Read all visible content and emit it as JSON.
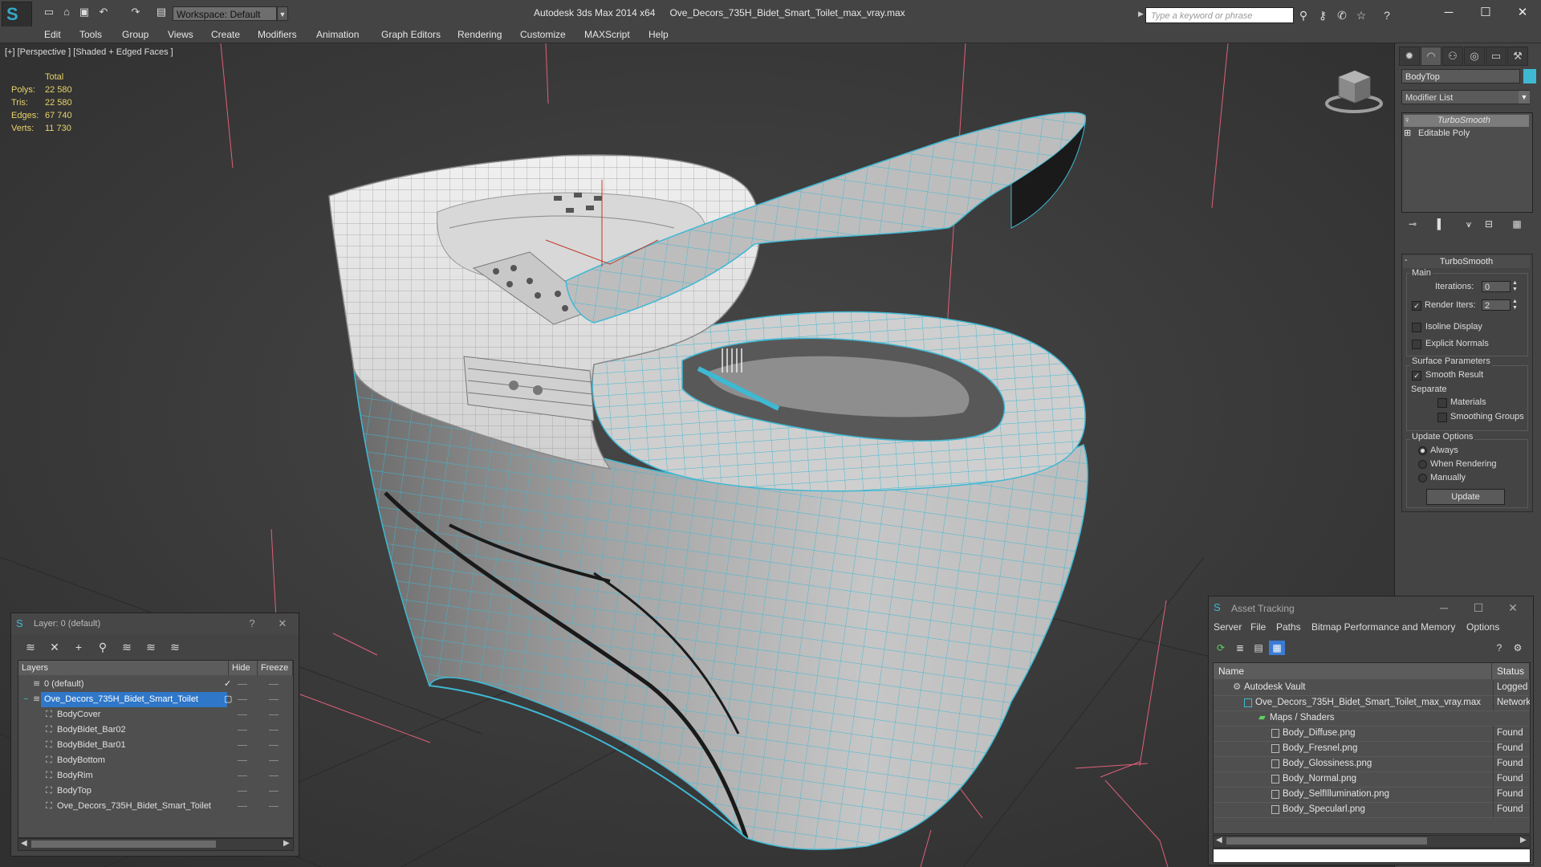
{
  "app": {
    "name": "Autodesk 3ds Max  2014 x64",
    "file": "Ove_Decors_735H_Bidet_Smart_Toilet_max_vray.max",
    "workspace": "Workspace: Default",
    "search_placeholder": "Type a keyword or phrase"
  },
  "menu": [
    "Edit",
    "Tools",
    "Group",
    "Views",
    "Create",
    "Modifiers",
    "Animation",
    "Graph Editors",
    "Rendering",
    "Customize",
    "MAXScript",
    "Help"
  ],
  "viewport": {
    "label": "[+] [Perspective ] [Shaded + Edged Faces ]",
    "stats": {
      "header": "Total",
      "rows": [
        {
          "k": "Polys:",
          "v": "22 580"
        },
        {
          "k": "Tris:",
          "v": "22 580"
        },
        {
          "k": "Edges:",
          "v": "67 740"
        },
        {
          "k": "Verts:",
          "v": "11 730"
        }
      ]
    },
    "colors": {
      "wire": "#3fb8d3",
      "grid": "#e0607a",
      "background": "#3a3a3a",
      "stats": "#e8d36a"
    }
  },
  "command_panel": {
    "object_name": "BodyTop",
    "object_color": "#3fb8d3",
    "modifier_list": "Modifier List",
    "stack": [
      "TurboSmooth",
      "Editable Poly"
    ],
    "rollout": {
      "title": "TurboSmooth",
      "main": "Main",
      "iterations_label": "Iterations:",
      "iterations": "0",
      "render_iters_label": "Render Iters:",
      "render_iters": "2",
      "isoline": "Isoline Display",
      "explicit_normals": "Explicit Normals",
      "surface_params": "Surface Parameters",
      "smooth_result": "Smooth Result",
      "separate": "Separate",
      "materials": "Materials",
      "smoothing_groups": "Smoothing Groups",
      "update_options": "Update Options",
      "always": "Always",
      "when_rendering": "When Rendering",
      "manually": "Manually",
      "update": "Update"
    }
  },
  "layer_window": {
    "title": "Layer: 0 (default)",
    "help": "?",
    "columns": [
      "Layers",
      "Hide",
      "Freeze"
    ],
    "rows": [
      {
        "name": "0 (default)"
      },
      {
        "name": "Ove_Decors_735H_Bidet_Smart_Toilet"
      },
      {
        "name": "BodyCover"
      },
      {
        "name": "BodyBidet_Bar02"
      },
      {
        "name": "BodyBidet_Bar01"
      },
      {
        "name": "BodyBottom"
      },
      {
        "name": "BodyRim"
      },
      {
        "name": "BodyTop"
      },
      {
        "name": "Ove_Decors_735H_Bidet_Smart_Toilet"
      }
    ]
  },
  "asset_tracking": {
    "title": "Asset Tracking",
    "menu": [
      "Server",
      "File",
      "Paths",
      "Bitmap Performance and Memory",
      "Options"
    ],
    "columns": [
      "Name",
      "Status"
    ],
    "rows": [
      {
        "name": "Autodesk Vault",
        "status": "Logged O"
      },
      {
        "name": "Ove_Decors_735H_Bidet_Smart_Toilet_max_vray.max",
        "status": "Network"
      },
      {
        "name": "Maps / Shaders",
        "status": ""
      },
      {
        "name": "Body_Diffuse.png",
        "status": "Found"
      },
      {
        "name": "Body_Fresnel.png",
        "status": "Found"
      },
      {
        "name": "Body_Glossiness.png",
        "status": "Found"
      },
      {
        "name": "Body_Normal.png",
        "status": "Found"
      },
      {
        "name": "Body_SelfIllumination.png",
        "status": "Found"
      },
      {
        "name": "Body_Specularl.png",
        "status": "Found"
      }
    ]
  }
}
